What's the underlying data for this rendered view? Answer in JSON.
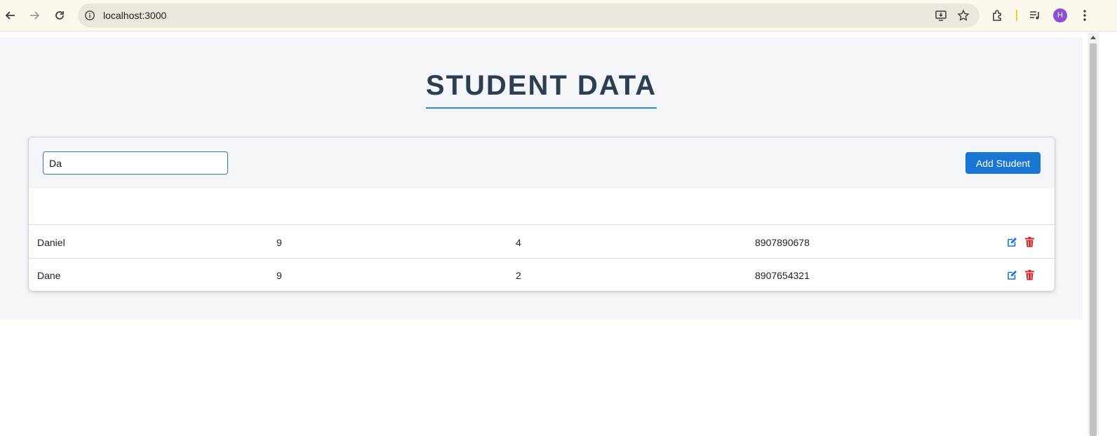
{
  "browser": {
    "url": "localhost:3000",
    "profile_initial": "H",
    "icons": [
      "back-icon",
      "forward-icon",
      "reload-icon",
      "info-icon",
      "install-icon",
      "star-icon",
      "extensions-icon",
      "media-icon",
      "menu-icon"
    ]
  },
  "page": {
    "title": "STUDENT DATA",
    "search": {
      "value": "Da",
      "placeholder": ""
    },
    "add_button_label": "Add Student",
    "table": {
      "rows": [
        {
          "name": "Daniel",
          "col2": "9",
          "col3": "4",
          "phone": "8907890678"
        },
        {
          "name": "Dane",
          "col2": "9",
          "col3": "2",
          "phone": "8907654321"
        }
      ]
    }
  },
  "colors": {
    "accent": "#1976d2",
    "title": "#2c3e50",
    "edit": "#1976d2",
    "delete": "#e02424",
    "background": "#f3f5f9"
  }
}
